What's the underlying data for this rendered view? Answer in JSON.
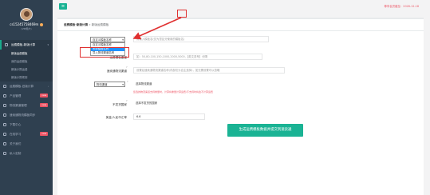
{
  "sidebar": {
    "username": "cs15245758469m",
    "role": "(VIP用户)",
    "items": [
      {
        "label": "运费模板-新版计算",
        "active": true
      },
      {
        "label": "新版运费模板",
        "sub": true,
        "current": true
      },
      {
        "label": "我的运费模板",
        "sub": true
      },
      {
        "label": "新版计算运费",
        "sub": true
      },
      {
        "label": "新版计算规则",
        "sub": true
      },
      {
        "label": "运费模板-旧版计算"
      },
      {
        "label": "产品管理",
        "badge": "new"
      },
      {
        "label": "物流渠道管理",
        "badge": "new"
      },
      {
        "label": "速卖通物流模板同步"
      },
      {
        "label": "下载中心"
      },
      {
        "label": "在线学习",
        "badge": "new"
      },
      {
        "label": "关于我们"
      },
      {
        "label": "私人定制"
      }
    ]
  },
  "topbar": {
    "menu_icon": "≡",
    "right_text": "尊享会员截至：2026-12-18"
  },
  "breadcrumb": {
    "main": "运费模板-新版计算",
    "sep": " » ",
    "current": "新版运费模板"
  },
  "form": {
    "template_select": "自定义模板名称",
    "template_placeholder": "请输入模板名(仅为您区分使用的模板名)",
    "dropdown_options": [
      "自定义模板名称",
      "系统模板名称",
      "导入物流渠道名称"
    ],
    "weight_label": "运费模板重量",
    "weight_placeholder": "如：50,80,100,150,1000,2000,5000,【英文逗号】分隔",
    "country_label": "速卖通物流渠道",
    "country_placeholder": "设置后速卖通物流渠道名称(内部仅为自主选择)，如无需设置可以忽略",
    "channel_select": "物流渠道",
    "channel_label": "选择物流渠道",
    "channel_note": "您选的物流渠道支持重量时，计算将重量计算运费/不支持时将会不计算运费",
    "exclude_label": "不发货国家",
    "exclude_placeholder": "选择不发货的国家",
    "multiplier_label": "美金/人民币汇率",
    "multiplier_value": "6.6",
    "generate_button": "生成运费模板数据并提交到速卖通"
  },
  "colors": {
    "sidebar_bg": "#2f4050",
    "accent": "#1ab394",
    "alert": "#e03030"
  }
}
